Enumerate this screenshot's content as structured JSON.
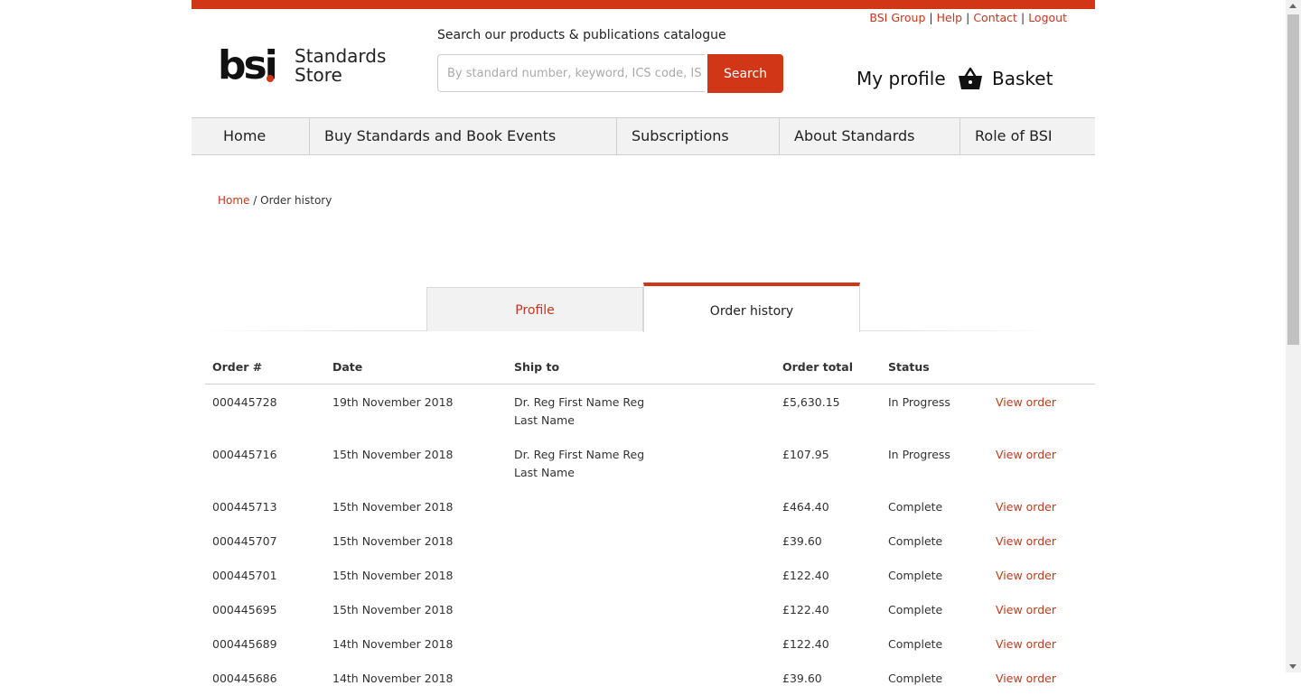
{
  "colors": {
    "brand": "#d13617",
    "link": "#c4381c",
    "nav_bg": "#f2f2f2"
  },
  "util_links": [
    "BSI Group",
    "Help",
    "Contact",
    "Logout"
  ],
  "logo": {
    "bsi": "bsi",
    "store_line1": "Standards",
    "store_line2": "Store"
  },
  "search": {
    "label": "Search our products & publications catalogue",
    "placeholder": "By standard number, keyword, ICS code, ISBN",
    "button": "Search"
  },
  "header": {
    "my_profile": "My profile",
    "basket": "Basket",
    "basket_icon": "basket-icon"
  },
  "nav": [
    "Home",
    "Buy Standards and Book Events",
    "Subscriptions",
    "About Standards",
    "Role of BSI"
  ],
  "breadcrumb": {
    "home": "Home",
    "separator": "/",
    "current": "Order history"
  },
  "tabs": {
    "profile": "Profile",
    "order_history": "Order history",
    "active": "Order history"
  },
  "orders": {
    "headers": [
      "Order #",
      "Date",
      "Ship to",
      "Order total",
      "Status",
      ""
    ],
    "rows": [
      {
        "order": "000445728",
        "date": "19th November 2018",
        "ship_to": "Dr. Reg First Name Reg Last Name",
        "total": "£5,630.15",
        "status": "In Progress",
        "action": "View order"
      },
      {
        "order": "000445716",
        "date": "15th November 2018",
        "ship_to": "Dr. Reg First Name Reg Last Name",
        "total": "£107.95",
        "status": "In Progress",
        "action": "View order"
      },
      {
        "order": "000445713",
        "date": "15th November 2018",
        "ship_to": "",
        "total": "£464.40",
        "status": "Complete",
        "action": "View order"
      },
      {
        "order": "000445707",
        "date": "15th November 2018",
        "ship_to": "",
        "total": "£39.60",
        "status": "Complete",
        "action": "View order"
      },
      {
        "order": "000445701",
        "date": "15th November 2018",
        "ship_to": "",
        "total": "£122.40",
        "status": "Complete",
        "action": "View order"
      },
      {
        "order": "000445695",
        "date": "15th November 2018",
        "ship_to": "",
        "total": "£122.40",
        "status": "Complete",
        "action": "View order"
      },
      {
        "order": "000445689",
        "date": "14th November 2018",
        "ship_to": "",
        "total": "£122.40",
        "status": "Complete",
        "action": "View order"
      },
      {
        "order": "000445686",
        "date": "14th November 2018",
        "ship_to": "",
        "total": "£39.60",
        "status": "Complete",
        "action": "View order"
      }
    ]
  }
}
